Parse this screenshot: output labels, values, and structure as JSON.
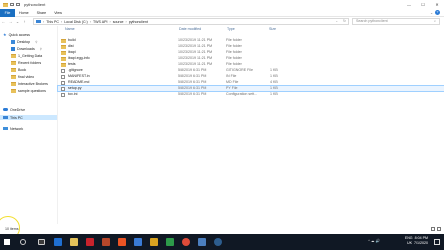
{
  "window": {
    "title": "pythonclient",
    "controls": {
      "minimize": "—",
      "maximize": "☐",
      "close": "✕"
    }
  },
  "ribbon": {
    "tabs": [
      "File",
      "Home",
      "Share",
      "View"
    ],
    "collapse_glyph": "⌄",
    "help_glyph": "?"
  },
  "address": {
    "back": "←",
    "forward": "→",
    "recent": "⌄",
    "up": "↑",
    "crumbs": [
      "This PC",
      "Local Disk (C:)",
      "TWS API",
      "source",
      "pythonclient"
    ],
    "separator": "›",
    "search_placeholder": "Search pythonclient"
  },
  "nav": {
    "quick_access": "Quick access",
    "quick_items": [
      "Desktop",
      "Downloads",
      "1_Getting Data",
      "Recent folders",
      "Book",
      "final video",
      "Interactive Brokers",
      "sample questions"
    ],
    "onedrive": "OneDrive",
    "this_pc": "This PC",
    "network": "Network"
  },
  "columns": {
    "name": "Name",
    "date": "Date modified",
    "type": "Type",
    "size": "Size"
  },
  "files": [
    {
      "name": "build",
      "date": "10/23/2019 11:21 PM",
      "type": "File folder",
      "size": "",
      "kind": "folder"
    },
    {
      "name": "dist",
      "date": "10/23/2019 11:21 PM",
      "type": "File folder",
      "size": "",
      "kind": "folder"
    },
    {
      "name": "ibapi",
      "date": "10/23/2019 11:21 PM",
      "type": "File folder",
      "size": "",
      "kind": "folder"
    },
    {
      "name": "ibapi.egg-info",
      "date": "10/23/2019 11:21 PM",
      "type": "File folder",
      "size": "",
      "kind": "folder"
    },
    {
      "name": "tests",
      "date": "10/23/2019 11:21 PM",
      "type": "File folder",
      "size": "",
      "kind": "folder"
    },
    {
      "name": ".gitignore",
      "date": "5/8/2019 6:31 PM",
      "type": "GITIGNORE File",
      "size": "1 KB",
      "kind": "file"
    },
    {
      "name": "MANIFEST.in",
      "date": "5/8/2019 6:31 PM",
      "type": "IN File",
      "size": "1 KB",
      "kind": "file"
    },
    {
      "name": "README.md",
      "date": "5/8/2019 6:31 PM",
      "type": "MD File",
      "size": "4 KB",
      "kind": "file"
    },
    {
      "name": "setup.py",
      "date": "5/8/2019 6:31 PM",
      "type": "PY File",
      "size": "1 KB",
      "kind": "file"
    },
    {
      "name": "tox.ini",
      "date": "5/8/2019 6:31 PM",
      "type": "Configuration sett...",
      "size": "1 KB",
      "kind": "file"
    }
  ],
  "status": {
    "items": "10 items"
  },
  "taskbar": {
    "time": "8:04 PM",
    "date": "7/1/2020",
    "lang": "ENG",
    "region": "UK",
    "tray": "^ ☁ 🔊"
  }
}
